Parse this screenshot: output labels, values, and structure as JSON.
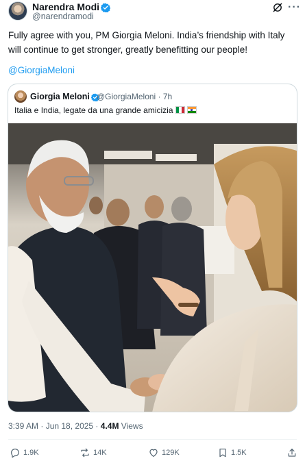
{
  "author": {
    "display_name": "Narendra Modi",
    "handle": "@narendramodi",
    "verified_color": "#1d9bf0"
  },
  "tweet": {
    "text": "Fully agree with you, PM Giorgia Meloni. India’s friendship with Italy will continue to get stronger, greatly benefitting our people!",
    "mention": "@GiorgiaMeloni"
  },
  "quoted": {
    "display_name": "Giorgia Meloni",
    "handle_time": "@GiorgiaMeloni · 7h",
    "text": "Italia e India, legate da una grande amicizia",
    "flags": [
      "flag-italy",
      "flag-india"
    ]
  },
  "meta": {
    "time_date": "3:39 AM · Jun 18, 2025 ·",
    "views_count": "4.4M",
    "views_label": "Views"
  },
  "actions": {
    "replies": "1.9K",
    "reposts": "14K",
    "likes": "129K",
    "bookmarks": "1.5K"
  },
  "colors": {
    "link": "#1d9bf0",
    "secondary_text": "#536471",
    "primary_text": "#0f1419",
    "border": "#cfd9de"
  }
}
